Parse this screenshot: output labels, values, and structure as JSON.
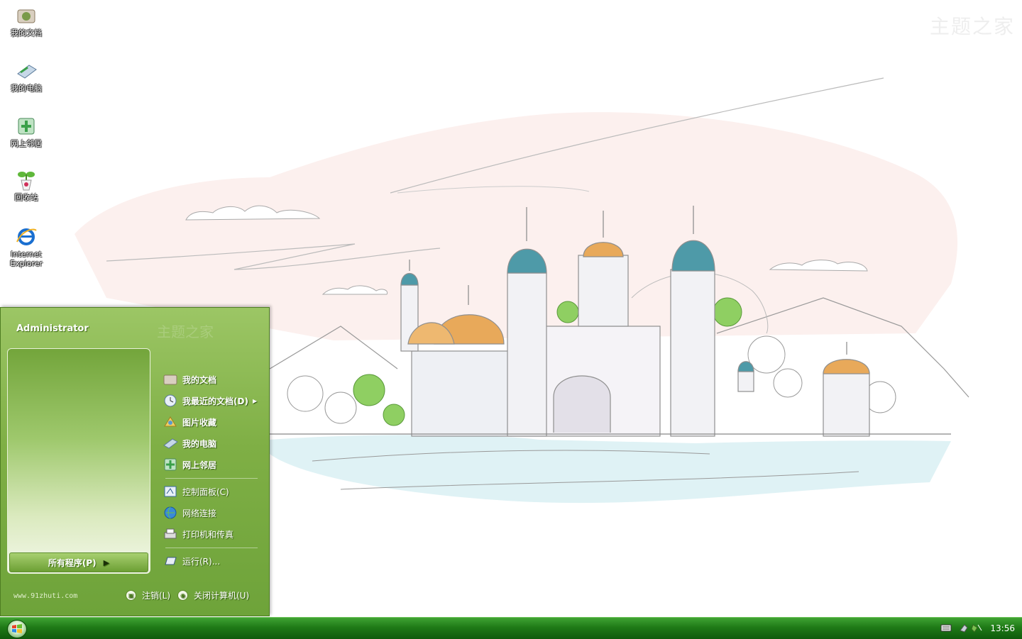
{
  "desktop": {
    "watermark": "主题之家",
    "icons": [
      {
        "label": "我的文档",
        "icon": "documents-icon"
      },
      {
        "label": "我的电脑",
        "icon": "computer-icon"
      },
      {
        "label": "网上邻居",
        "icon": "network-icon"
      },
      {
        "label": "回收站",
        "icon": "recycle-bin-icon"
      },
      {
        "label": "Internet Explorer",
        "icon": "internet-explorer-icon"
      }
    ]
  },
  "start_menu": {
    "user": "Administrator",
    "watermark": "主题之家",
    "all_programs": "所有程序(P)",
    "right_items": [
      {
        "label": "我的文档",
        "icon": "documents-icon"
      },
      {
        "label": "我最近的文档(D)",
        "icon": "recent-documents-icon"
      },
      {
        "label": "图片收藏",
        "icon": "pictures-icon"
      },
      {
        "label": "我的电脑",
        "icon": "computer-icon"
      },
      {
        "label": "网上邻居",
        "icon": "network-icon"
      },
      {
        "label": "控制面板(C)",
        "icon": "control-panel-icon"
      },
      {
        "label": "网络连接",
        "icon": "network-connections-icon"
      },
      {
        "label": "打印机和传真",
        "icon": "printer-icon"
      },
      {
        "label": "运行(R)...",
        "icon": "run-icon"
      }
    ],
    "site": "www.91zhuti.com",
    "logoff": "注销(L)",
    "shutdown": "关闭计算机(U)"
  },
  "taskbar": {
    "clock": "13:56"
  },
  "colors": {
    "menu_green": "#7faf45",
    "taskbar_green": "#1f7a17"
  }
}
